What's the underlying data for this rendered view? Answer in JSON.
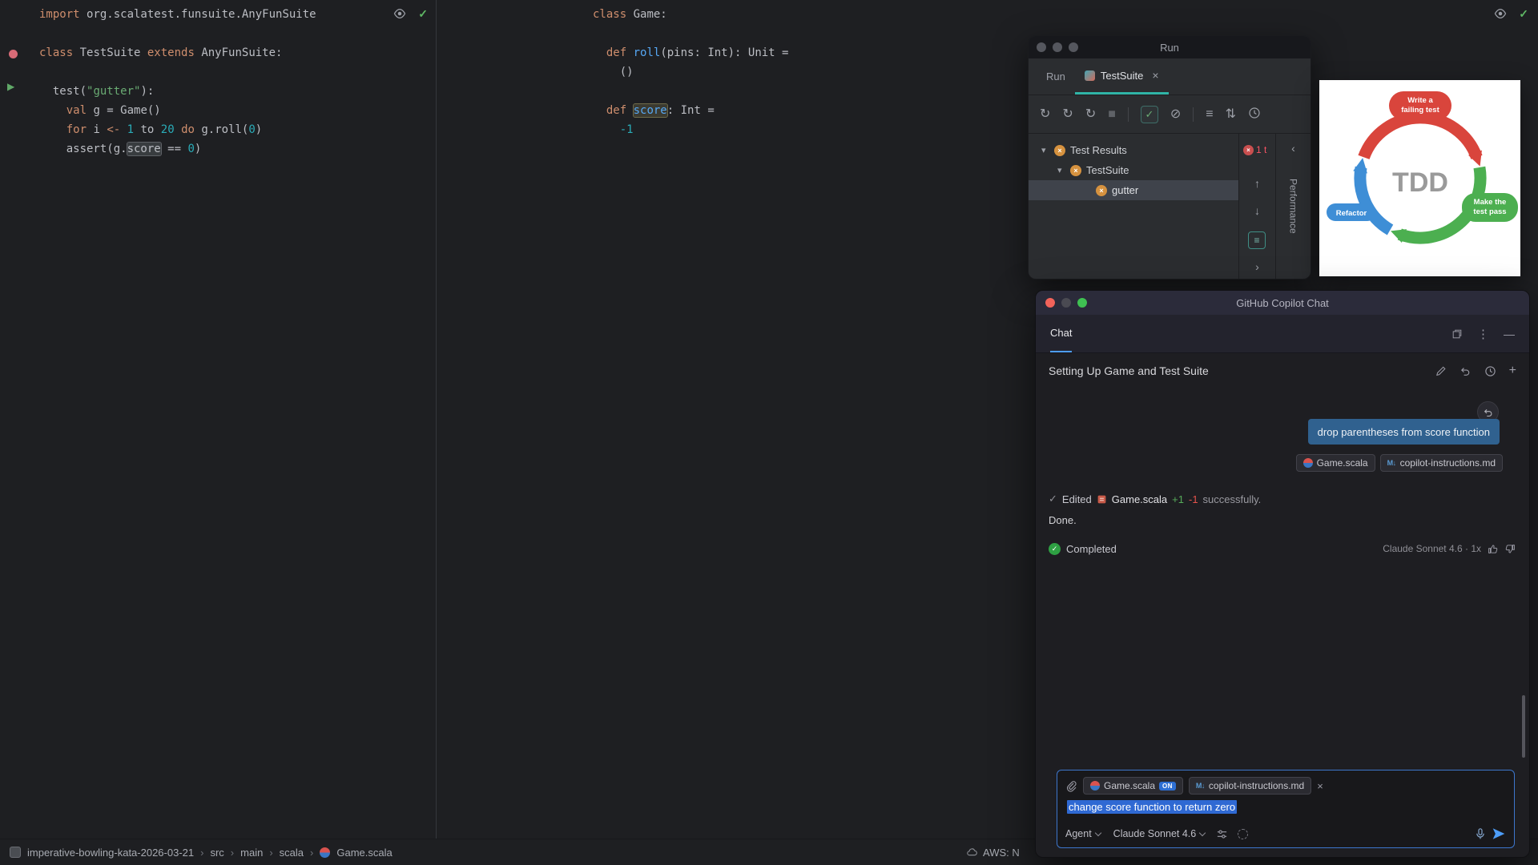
{
  "icons": {
    "check": "✓",
    "close": "×",
    "rerun": "↻",
    "stop": "■",
    "skip": "⊘",
    "sort": "≡",
    "updown": "⇅",
    "up": "↑",
    "down": "↓",
    "chev_down": "▾",
    "chev_right": "›",
    "chev_left": "‹",
    "kebab": "⋮",
    "minimize": "—",
    "plus": "+",
    "play": "▶"
  },
  "editors": {
    "left": {
      "lines": [
        [
          [
            "kw",
            "import"
          ],
          [
            "fg",
            " org.scalatest.funsuite.AnyFunSuite"
          ]
        ],
        [],
        [
          [
            "kw",
            "class"
          ],
          [
            "fg",
            " TestSuite "
          ],
          [
            "kw",
            "extends"
          ],
          [
            "fg",
            " AnyFunSuite:"
          ]
        ],
        [],
        [
          [
            "fg",
            "  test("
          ],
          [
            "str",
            "\"gutter\""
          ],
          [
            "fg",
            "):"
          ]
        ],
        [
          [
            "fg",
            "    "
          ],
          [
            "kw",
            "val"
          ],
          [
            "fg",
            " g = Game()"
          ]
        ],
        [
          [
            "fg",
            "    "
          ],
          [
            "kw",
            "for"
          ],
          [
            "fg",
            " i "
          ],
          [
            "kw",
            "<-"
          ],
          [
            "fg",
            " "
          ],
          [
            "num",
            "1"
          ],
          [
            "fg",
            " to "
          ],
          [
            "num",
            "20"
          ],
          [
            "fg",
            " "
          ],
          [
            "kw",
            "do"
          ],
          [
            "fg",
            " g.roll("
          ],
          [
            "num",
            "0"
          ],
          [
            "fg",
            ")"
          ]
        ],
        [
          [
            "fg",
            "    assert(g."
          ],
          [
            "hl",
            "score"
          ],
          [
            "fg",
            " == "
          ],
          [
            "num",
            "0"
          ],
          [
            "fg",
            ")"
          ]
        ]
      ]
    },
    "middle": {
      "lines": [
        [
          [
            "kw",
            "class"
          ],
          [
            "fg",
            " Game:"
          ]
        ],
        [],
        [
          [
            "fg",
            "  "
          ],
          [
            "kw",
            "def"
          ],
          [
            "fg",
            " "
          ],
          [
            "fn",
            "roll"
          ],
          [
            "fg",
            "(pins: Int): Unit ="
          ]
        ],
        [
          [
            "fg",
            "    ()"
          ]
        ],
        [],
        [
          [
            "fg",
            "  "
          ],
          [
            "kw",
            "def"
          ],
          [
            "fg",
            " "
          ],
          [
            "fnhl",
            "score"
          ],
          [
            "fg",
            ": Int ="
          ]
        ],
        [
          [
            "fg",
            "    "
          ],
          [
            "num",
            "-1"
          ]
        ]
      ]
    }
  },
  "run_window": {
    "title": "Run",
    "tab_run": "Run",
    "tab_testsuite": "TestSuite",
    "tree": [
      {
        "label": "Test Results"
      },
      {
        "label": "TestSuite"
      },
      {
        "label": "gutter"
      }
    ],
    "error_badge": "1 t",
    "side_tab_label": "Performance"
  },
  "tdd_diagram": {
    "center_label": "TDD",
    "steps": [
      {
        "line1": "Write a",
        "line2": "failing test",
        "color": "#d9453c"
      },
      {
        "line1": "Make the",
        "line2": "test pass",
        "color": "#4caf50"
      },
      {
        "line1": "Refactor",
        "line2": "",
        "color": "#3e8ed6"
      }
    ]
  },
  "copilot": {
    "window_title": "GitHub Copilot Chat",
    "tab_label": "Chat",
    "section_title": "Setting Up Game and Test Suite",
    "user_message": "drop parentheses from score function",
    "message_chip1": "Game.scala",
    "message_chip2": "copilot-instructions.md",
    "edited": {
      "label": "Edited",
      "file": "Game.scala",
      "added": "+1",
      "removed": "-1",
      "suffix": "successfully."
    },
    "done_label": "Done.",
    "completed_label": "Completed",
    "model_info": "Claude Sonnet 4.6 · 1x",
    "input": {
      "chip1": "Game.scala",
      "chip1_badge": "ON",
      "chip2": "copilot-instructions.md",
      "value": "change score function to return zero",
      "mode_label": "Agent",
      "model_label": "Claude Sonnet 4.6"
    }
  },
  "statusbar": {
    "crumbs": [
      "imperative-bowling-kata-2026-03-21",
      "src",
      "main",
      "scala"
    ],
    "file": "Game.scala",
    "aws": "AWS: N"
  }
}
